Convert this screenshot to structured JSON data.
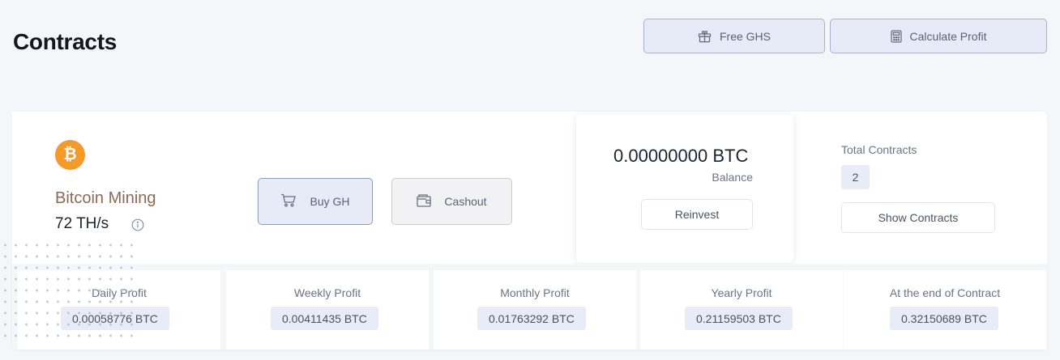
{
  "page": {
    "title": "Contracts"
  },
  "header": {
    "free_ghs_label": "Free GHS",
    "calculate_profit_label": "Calculate Profit"
  },
  "mining": {
    "coin_symbol": "₿",
    "name": "Bitcoin Mining",
    "hashrate": "72 TH/s",
    "buy_label": "Buy GH",
    "cashout_label": "Cashout"
  },
  "balance": {
    "value": "0.00000000 BTC",
    "label": "Balance",
    "reinvest_label": "Reinvest"
  },
  "contracts": {
    "total_label": "Total Contracts",
    "total_count": "2",
    "show_label": "Show Contracts"
  },
  "stats": [
    {
      "label": "Daily Profit",
      "value": "0.00058776 BTC"
    },
    {
      "label": "Weekly Profit",
      "value": "0.00411435 BTC"
    },
    {
      "label": "Monthly Profit",
      "value": "0.01763292 BTC"
    },
    {
      "label": "Yearly Profit",
      "value": "0.21159503 BTC"
    },
    {
      "label": "At the end of Contract",
      "value": "0.32150689 BTC"
    }
  ],
  "colors": {
    "accent_orange": "#f39a2a",
    "button_blue_bg": "#e6ebf7",
    "badge_bg": "#e8ecf6",
    "page_bg": "#f4f6fa"
  }
}
